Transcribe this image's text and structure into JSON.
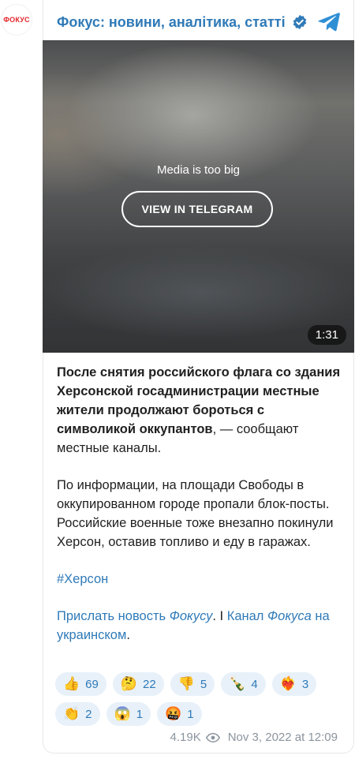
{
  "avatar": {
    "logo_text": "ФОКУС"
  },
  "header": {
    "title": "Фокус: новини, аналітика, статті"
  },
  "media": {
    "message": "Media is too big",
    "button": "VIEW IN TELEGRAM",
    "duration": "1:31"
  },
  "post": {
    "bold": "После снятия российского флага со здания Херсонской госадминистрации местные жители продолжают бороться с символикой оккупантов",
    "bold_tail": ", — сообщают местные каналы.",
    "para2": "По информации, на площади Свободы в оккупированном городе пропали блок-посты. Российские военные тоже внезапно покинули Херсон, оставив топливо и еду в гаражах.",
    "hashtag": "#Херсон",
    "link1": "Прислать новость",
    "link1_italic": "Фокусу",
    "separator": ". I ",
    "link2": "Канал",
    "link2_italic": "Фокуса",
    "link2_tail": " на украинском",
    "period": "."
  },
  "reactions": [
    {
      "emoji": "👍",
      "count": "69"
    },
    {
      "emoji": "🤔",
      "count": "22"
    },
    {
      "emoji": "👎",
      "count": "5"
    },
    {
      "emoji": "🍾",
      "count": "4"
    },
    {
      "emoji": "❤️‍🔥",
      "count": "3"
    },
    {
      "emoji": "👏",
      "count": "2"
    },
    {
      "emoji": "😱",
      "count": "1"
    },
    {
      "emoji": "🤬",
      "count": "1"
    }
  ],
  "footer": {
    "views": "4.19K",
    "date": "Nov 3, 2022 at 12:09"
  },
  "icons": {
    "verified": "verified-badge-icon",
    "telegram": "telegram-icon",
    "eye": "eye-icon"
  },
  "colors": {
    "link": "#2f7ab8",
    "logo": "#e3262b",
    "chip": "#e8f1f9"
  }
}
